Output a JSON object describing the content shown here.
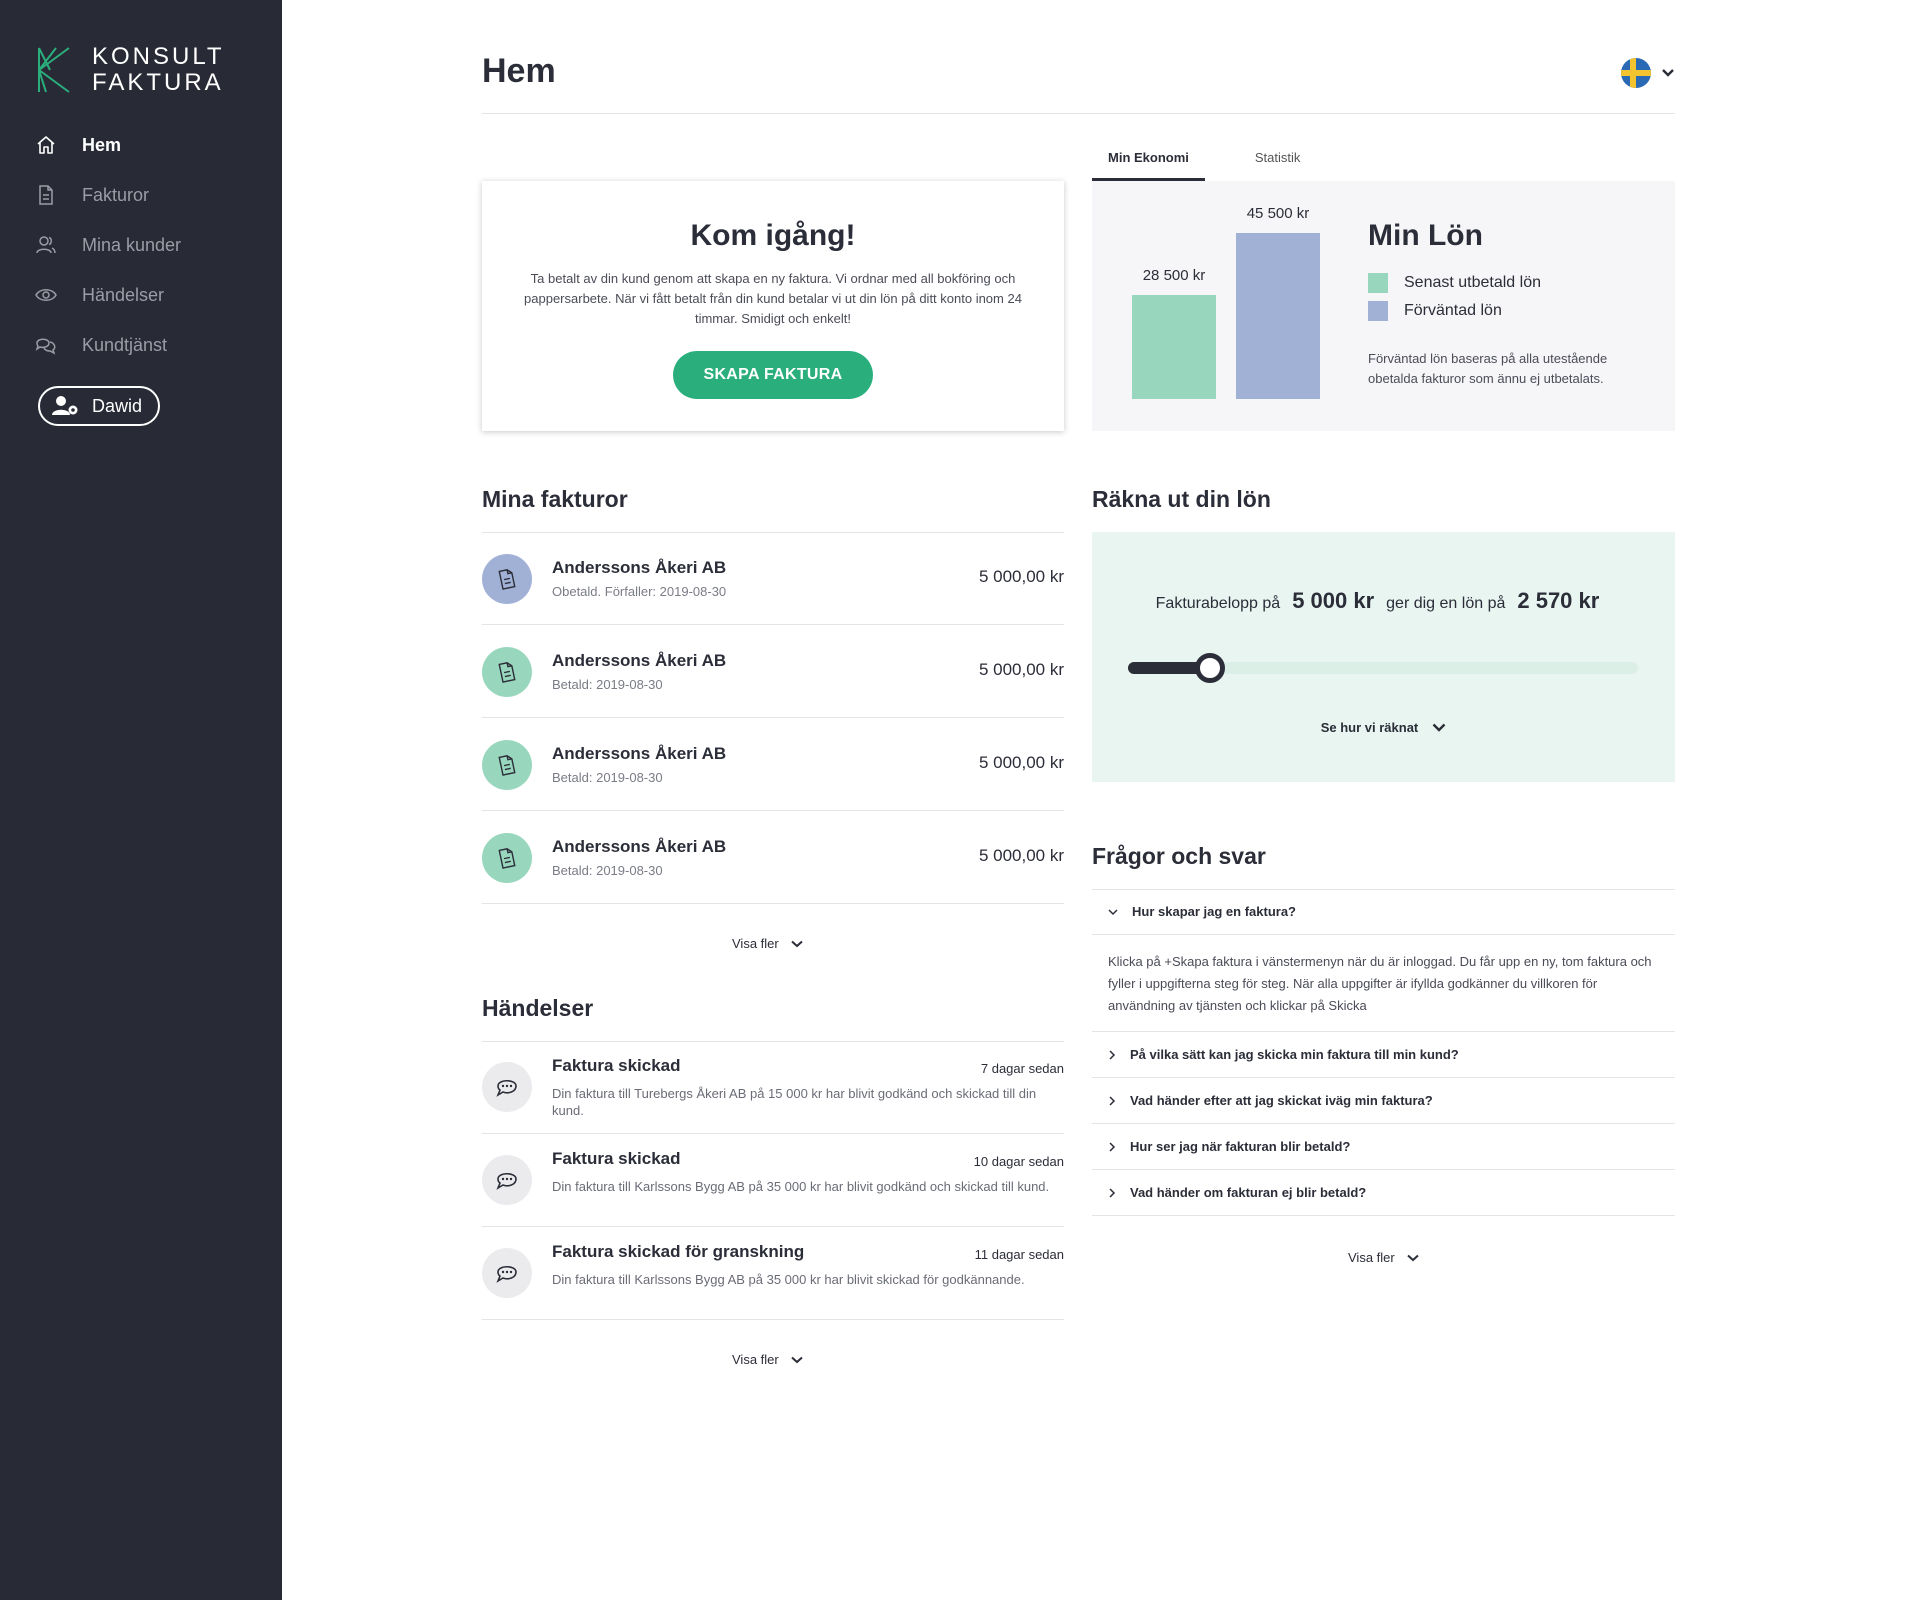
{
  "sidebar": {
    "logo": {
      "line1": "KONSULT",
      "line2": "FAKTURA"
    },
    "items": [
      {
        "label": "Hem",
        "icon": "home-icon",
        "active": true
      },
      {
        "label": "Fakturor",
        "icon": "document-icon"
      },
      {
        "label": "Mina kunder",
        "icon": "users-icon"
      },
      {
        "label": "Händelser",
        "icon": "eye-icon"
      },
      {
        "label": "Kundtjänst",
        "icon": "chat-icon"
      }
    ],
    "user": {
      "label": "Dawid",
      "icon": "user-gear-icon"
    }
  },
  "header": {
    "title": "Hem",
    "language": {
      "icon": "swedish-flag-icon"
    }
  },
  "start_card": {
    "title": "Kom igång!",
    "text": "Ta betalt av din kund genom att skapa en ny faktura. Vi ordnar med all bokföring och pappersarbete. När vi fått betalt från din kund betalar vi ut din lön på ditt konto inom 24 timmar. Smidigt och enkelt!",
    "button": "SKAPA FAKTURA"
  },
  "economy": {
    "tabs": [
      {
        "label": "Min Ekonomi",
        "active": true
      },
      {
        "label": "Statistik"
      }
    ],
    "title": "Min Lön",
    "legend": [
      {
        "label": "Senast utbetald lön",
        "color": "#98d7bd"
      },
      {
        "label": "Förväntad lön",
        "color": "#a1b1d6"
      }
    ],
    "note": "Förväntad lön baseras på alla utestående obetalda fakturor som ännu ej utbetalats."
  },
  "chart_data": {
    "type": "bar",
    "categories": [
      "Senast utbetald lön",
      "Förväntad lön"
    ],
    "values": [
      28500,
      45500
    ],
    "data_labels": [
      "28 500 kr",
      "45 500 kr"
    ],
    "colors": [
      "#98d7bd",
      "#a1b1d6"
    ]
  },
  "invoices": {
    "title": "Mina fakturor",
    "items": [
      {
        "name": "Anderssons Åkeri AB",
        "status": "Obetald. Förfaller: 2019-08-30",
        "amount": "5 000,00 kr",
        "color": "#a1b1d6"
      },
      {
        "name": "Anderssons Åkeri AB",
        "status": "Betald: 2019-08-30",
        "amount": "5 000,00 kr",
        "color": "#98d7bd"
      },
      {
        "name": "Anderssons Åkeri AB",
        "status": "Betald: 2019-08-30",
        "amount": "5 000,00 kr",
        "color": "#98d7bd"
      },
      {
        "name": "Anderssons Åkeri AB",
        "status": "Betald: 2019-08-30",
        "amount": "5 000,00 kr",
        "color": "#98d7bd"
      }
    ],
    "more": "Visa fler"
  },
  "events": {
    "title": "Händelser",
    "items": [
      {
        "title": "Faktura skickad",
        "time": "7 dagar sedan",
        "text": "Din faktura till Turebergs Åkeri AB på 15 000 kr har blivit godkänd och skickad till din kund."
      },
      {
        "title": "Faktura skickad",
        "time": "10 dagar sedan",
        "text": "Din faktura till Karlssons Bygg AB på 35 000 kr har blivit godkänd och skickad till kund."
      },
      {
        "title": "Faktura skickad för granskning",
        "time": "11 dagar sedan",
        "text": "Din faktura till Karlssons Bygg AB på 35 000 kr har blivit skickad för godkännande."
      }
    ],
    "more": "Visa fler"
  },
  "calculator": {
    "title": "Räkna ut din lön",
    "prefix": "Fakturabelopp på",
    "amount": "5 000 kr",
    "middle": "ger dig en lön på",
    "salary": "2 570 kr",
    "slider_fraction": 0.16,
    "more": "Se hur vi räknat"
  },
  "faq": {
    "title": "Frågor och svar",
    "items": [
      {
        "q": "Hur skapar jag en faktura?",
        "open": true,
        "a": "Klicka på +Skapa faktura i vänstermenyn när du är inloggad. Du får upp en ny, tom faktura och fyller i uppgifterna steg för steg. När alla uppgifter är ifyllda godkänner du villkoren för användning av tjänsten och klickar på Skicka"
      },
      {
        "q": "På vilka sätt kan jag skicka min faktura till min kund?"
      },
      {
        "q": "Vad händer efter att jag skickat iväg min faktura?"
      },
      {
        "q": "Hur ser jag när fakturan blir betald?"
      },
      {
        "q": "Vad händer om fakturan ej blir betald?"
      }
    ],
    "more": "Visa fler"
  }
}
